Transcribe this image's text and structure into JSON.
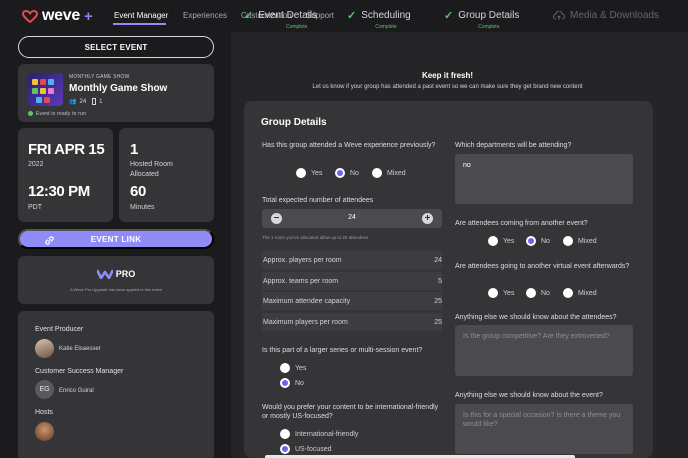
{
  "brand": {
    "logo_text": "weve",
    "logo_plus": "+"
  },
  "nav": {
    "items": [
      "Event Manager",
      "Experiences",
      "Customization",
      "Support"
    ]
  },
  "sidebar": {
    "select_event_label": "SELECT EVENT",
    "event": {
      "category": "MONTHLY GAME SHOW",
      "title": "Monthly Game Show",
      "attendees": "24",
      "rooms": "1",
      "status": "Event is ready to run"
    },
    "date": {
      "day": "FRI APR 15",
      "year": "2022",
      "time": "12:30 PM",
      "tz": "PDT"
    },
    "rooms": {
      "count": "1",
      "label_line1": "Hosted Room",
      "label_line2": "Allocated"
    },
    "duration": {
      "value": "60",
      "unit": "Minutes"
    },
    "event_link_label": "EVENT LINK",
    "pro": {
      "label": "PRO",
      "note": "A Weve Pro Upgrade has been applied to this event"
    },
    "people": {
      "producer_heading": "Event Producer",
      "producer_name": "Katie Elsaesser",
      "csm_heading": "Customer Success Manager",
      "csm_initials": "EG",
      "csm_name": "Enrico Guiral",
      "hosts_heading": "Hosts"
    }
  },
  "steps": [
    {
      "label": "Event Details",
      "sub": "Complete"
    },
    {
      "label": "Scheduling",
      "sub": "Complete"
    },
    {
      "label": "Group Details",
      "sub": "Complete"
    },
    {
      "label": "Media & Downloads",
      "sub": ""
    }
  ],
  "intro": {
    "title": "Keep it fresh!",
    "text": "Let us know if your group has attended a past event so we can make sure they get brand new content"
  },
  "form": {
    "title": "Group Details",
    "q_attended": "Has this group attended a Weve experience previously?",
    "attended_options": [
      "Yes",
      "No",
      "Mixed"
    ],
    "q_attendees": "Total expected number of attendees",
    "attendees_value": "24",
    "attendees_note": "The 1 room you've allocated allow up to 25 attendees",
    "stats": [
      {
        "label": "Approx. players per room",
        "value": "24"
      },
      {
        "label": "Approx. teams per room",
        "value": "5"
      },
      {
        "label": "Maximum attendee capacity",
        "value": "25"
      },
      {
        "label": "Maximum players per room",
        "value": "25"
      }
    ],
    "q_series": "Is this part of a larger series or multi-session event?",
    "series_options": [
      "Yes",
      "No"
    ],
    "q_intl": "Would you prefer your content to be international-friendly or mostly US-focused?",
    "intl_options": [
      "International-friendly",
      "US-focused"
    ],
    "q_departments": "Which departments will be attending?",
    "departments_value": "no",
    "q_another_event": "Are attendees coming from another event?",
    "another_event_options": [
      "Yes",
      "No",
      "Mixed"
    ],
    "q_virtual_after": "Are attendees going to another virtual event afterwards?",
    "virtual_after_options": [
      "Yes",
      "No",
      "Mixed"
    ],
    "q_know_attendees": "Anything else we should know about the attendees?",
    "know_attendees_placeholder": "Is the group competitive? Are they extroverted?",
    "q_know_event": "Anything else we should know about the event?",
    "know_event_placeholder": "Is this for a special occasion? Is there a theme you would like?"
  },
  "colors": {
    "accent": "#8f8cf7",
    "success": "#5fc36a",
    "logo": "#e5484d"
  }
}
